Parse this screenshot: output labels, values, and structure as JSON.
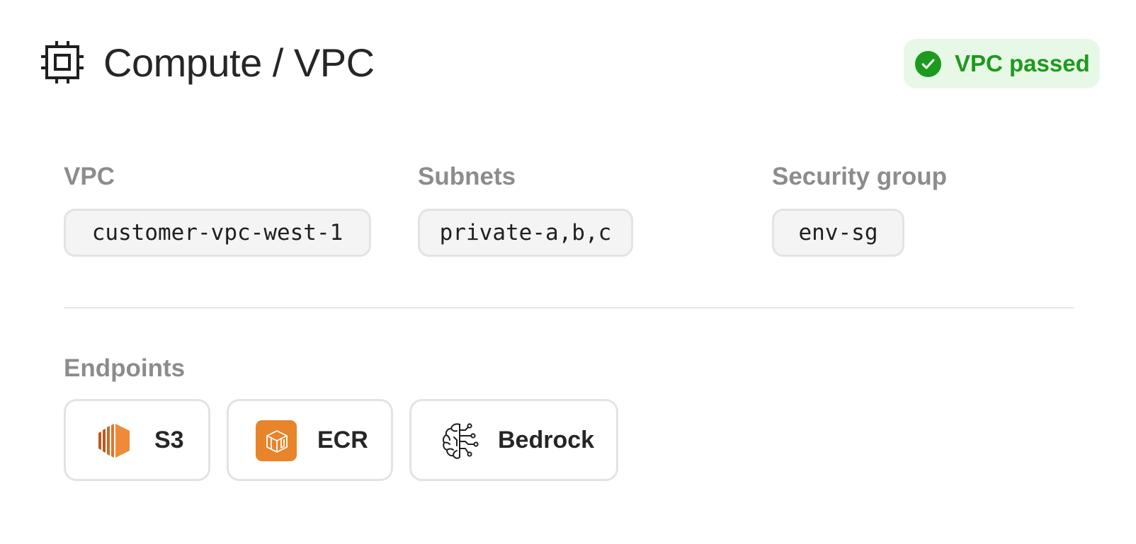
{
  "header": {
    "title": "Compute / VPC",
    "icon": "cpu-chip-icon"
  },
  "status": {
    "label": "VPC passed",
    "icon": "check-circle-icon",
    "color": "#1d9a1d",
    "background": "#e8f8e6"
  },
  "fields": {
    "vpc": {
      "label": "VPC",
      "value": "customer-vpc-west-1"
    },
    "subnets": {
      "label": "Subnets",
      "value": "private-a,b,c"
    },
    "security_group": {
      "label": "Security group",
      "value": "env-sg"
    }
  },
  "endpoints": {
    "title": "Endpoints",
    "items": [
      {
        "label": "S3",
        "icon": "aws-s3-icon"
      },
      {
        "label": "ECR",
        "icon": "aws-ecr-icon"
      },
      {
        "label": "Bedrock",
        "icon": "aws-bedrock-brain-icon"
      }
    ]
  },
  "colors": {
    "aws_orange": "#e8842a",
    "aws_orange_dark": "#c2561f"
  }
}
